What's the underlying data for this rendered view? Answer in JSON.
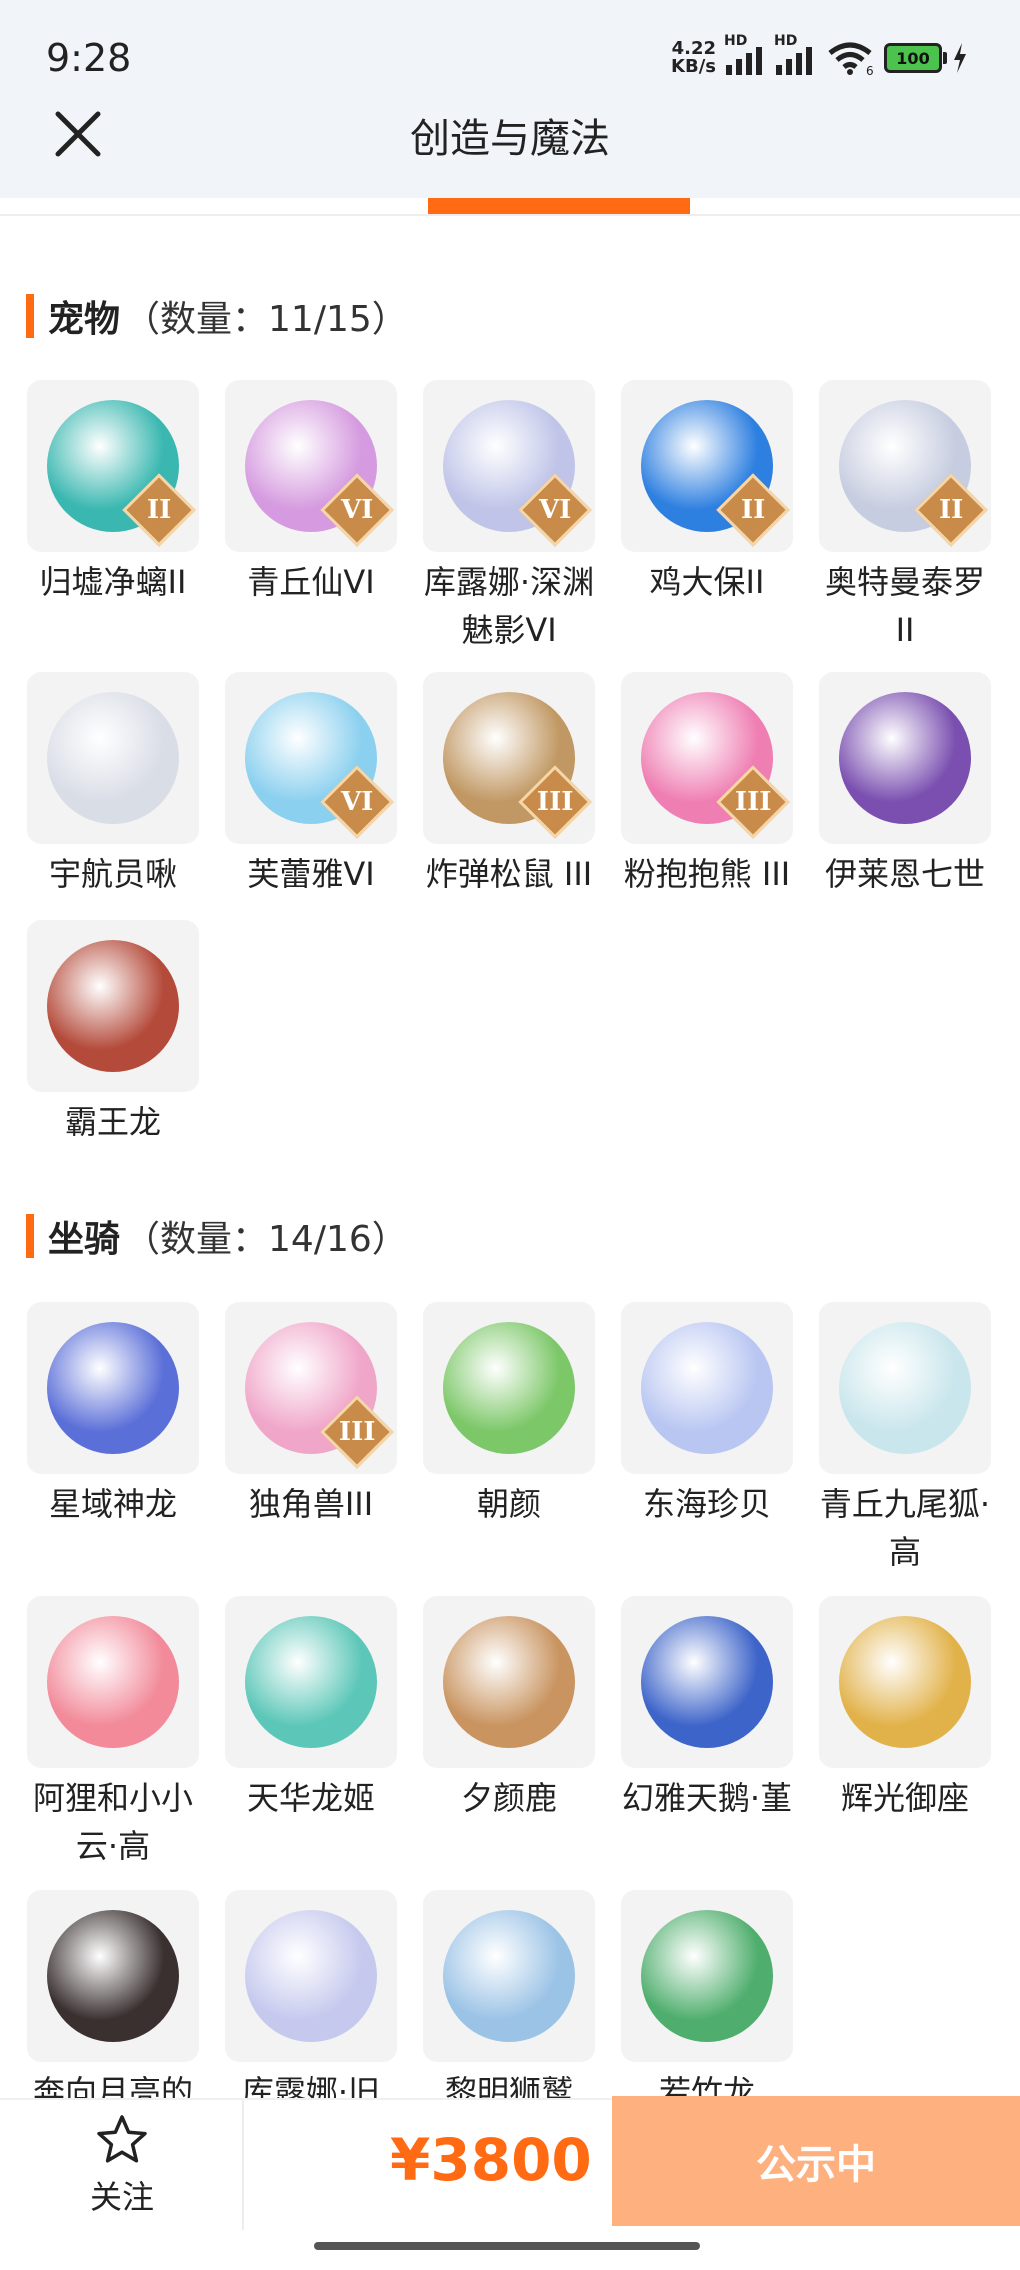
{
  "status_bar": {
    "time": "9:28",
    "net_speed_value": "4.22",
    "net_speed_unit": "KB/s",
    "hd1": "HD",
    "hd2": "HD",
    "wifi_badge": "6",
    "battery": "100"
  },
  "header": {
    "title": "创造与魔法"
  },
  "pets": {
    "title": "宠物",
    "count": "（数量：11/15）",
    "items": [
      {
        "label": "归墟净螭II",
        "badge": "II",
        "icon": "dragon-pet",
        "color": "#39b7b0"
      },
      {
        "label": "青丘仙VI",
        "badge": "VI",
        "icon": "fox-fairy",
        "color": "#d59adf"
      },
      {
        "label": "库露娜·深渊魅影VI",
        "badge": "VI",
        "icon": "sorceress",
        "color": "#bfc4e8"
      },
      {
        "label": "鸡大保II",
        "badge": "II",
        "icon": "blue-bird",
        "color": "#2d7fe0"
      },
      {
        "label": "奥特曼泰罗II",
        "badge": "II",
        "icon": "ultraman",
        "color": "#c7cde0"
      },
      {
        "label": "宇航员啾",
        "badge": "",
        "icon": "astronaut",
        "color": "#d9dde6"
      },
      {
        "label": "芙蕾雅VI",
        "badge": "VI",
        "icon": "valkyrie",
        "color": "#8bd0ef"
      },
      {
        "label": "炸弹松鼠 III",
        "badge": "III",
        "icon": "squirrel",
        "color": "#c19863"
      },
      {
        "label": "粉抱抱熊 III",
        "badge": "III",
        "icon": "pink-bear",
        "color": "#ef7fb3"
      },
      {
        "label": "伊莱恩七世",
        "badge": "",
        "icon": "pharaoh",
        "color": "#7a4fb0"
      },
      {
        "label": "霸王龙",
        "badge": "",
        "icon": "t-rex",
        "color": "#b44a3a"
      }
    ]
  },
  "mounts": {
    "title": "坐骑",
    "count": "（数量：14/16）",
    "items": [
      {
        "label": "星域神龙",
        "icon": "star-dragon",
        "color": "#5b6fd8"
      },
      {
        "label": "独角兽III",
        "badge": "III",
        "icon": "unicorn",
        "color": "#f0a6c9"
      },
      {
        "label": "朝颜",
        "icon": "morning-glory",
        "color": "#7cc768"
      },
      {
        "label": "东海珍贝",
        "icon": "pearl-shell",
        "color": "#b9c6f2"
      },
      {
        "label": "青丘九尾狐·高",
        "icon": "nine-tail-fox",
        "color": "#c9e6ec"
      },
      {
        "label": "阿狸和小小云·高",
        "icon": "ahri-cloud",
        "color": "#f28a9a"
      },
      {
        "label": "天华龙姬",
        "icon": "dragon-princess",
        "color": "#5cc7b8"
      },
      {
        "label": "夕颜鹿",
        "icon": "deer",
        "color": "#c99460"
      },
      {
        "label": "幻雅天鹅·堇",
        "icon": "swan",
        "color": "#3d64c9"
      },
      {
        "label": "辉光御座",
        "icon": "throne",
        "color": "#e2b24a"
      },
      {
        "label": "奔向月亮的",
        "icon": "pig",
        "color": "#3a3030"
      },
      {
        "label": "库露娜·旧",
        "icon": "sorceress-2",
        "color": "#c6c9ee"
      },
      {
        "label": "黎明狮鹫",
        "icon": "griffin",
        "color": "#9bc3e6"
      },
      {
        "label": "若竹龙",
        "icon": "bamboo-dragon",
        "color": "#4fae6d"
      }
    ]
  },
  "bottom_bar": {
    "follow_label": "关注",
    "price": "¥3800",
    "status_button": "公示中"
  }
}
